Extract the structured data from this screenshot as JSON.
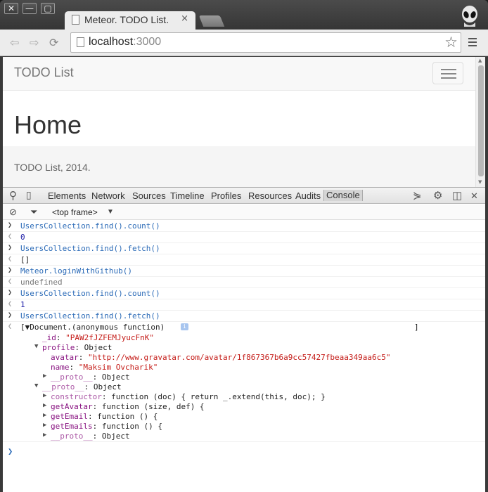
{
  "window": {
    "minimize": "—",
    "maximize": "▢",
    "close": "✕"
  },
  "tab": {
    "title": "Meteor. TODO List.",
    "close": "×"
  },
  "omnibox": {
    "host": "localhost",
    "port": ":3000"
  },
  "page": {
    "brand": "TODO List",
    "heading": "Home",
    "footer": "TODO List, 2014."
  },
  "devtools": {
    "tabs": [
      "Elements",
      "Network",
      "Sources",
      "Timeline",
      "Profiles",
      "Resources",
      "Audits",
      "Console"
    ],
    "active_tab": "Console",
    "frame": "<top frame>",
    "lines": [
      {
        "kind": "in",
        "text": "UsersCollection.find().count()"
      },
      {
        "kind": "num",
        "text": "0"
      },
      {
        "kind": "in",
        "text": "UsersCollection.find().fetch()"
      },
      {
        "kind": "out",
        "text": "[]"
      },
      {
        "kind": "in",
        "text": "Meteor.loginWithGithub()"
      },
      {
        "kind": "undef",
        "text": "undefined"
      },
      {
        "kind": "in",
        "text": "UsersCollection.find().count()"
      },
      {
        "kind": "num",
        "text": "1"
      },
      {
        "kind": "in",
        "text": "UsersCollection.find().fetch()"
      }
    ],
    "tree": {
      "head": "[▼Document.(anonymous function)",
      "close_bracket": "]",
      "id_key": "_id",
      "id_val": "\"PAW2fJZFEMJyucFnK\"",
      "profile_key": "profile",
      "profile_val": "Object",
      "avatar_key": "avatar",
      "avatar_val": "\"http://www.gravatar.com/avatar/1f867367b6a9cc57427fbeaa349aa6c5\"",
      "name_key": "name",
      "name_val": "\"Maksim Ovcharik\"",
      "proto_key": "__proto__",
      "proto_val": "Object",
      "constructor_key": "constructor",
      "constructor_val": "function (doc) { return _.extend(this, doc); }",
      "getAvatar_key": "getAvatar",
      "getAvatar_val": "function (size, def) {",
      "getEmail_key": "getEmail",
      "getEmail_val": "function () {",
      "getEmails_key": "getEmails",
      "getEmails_val": "function () {"
    }
  }
}
